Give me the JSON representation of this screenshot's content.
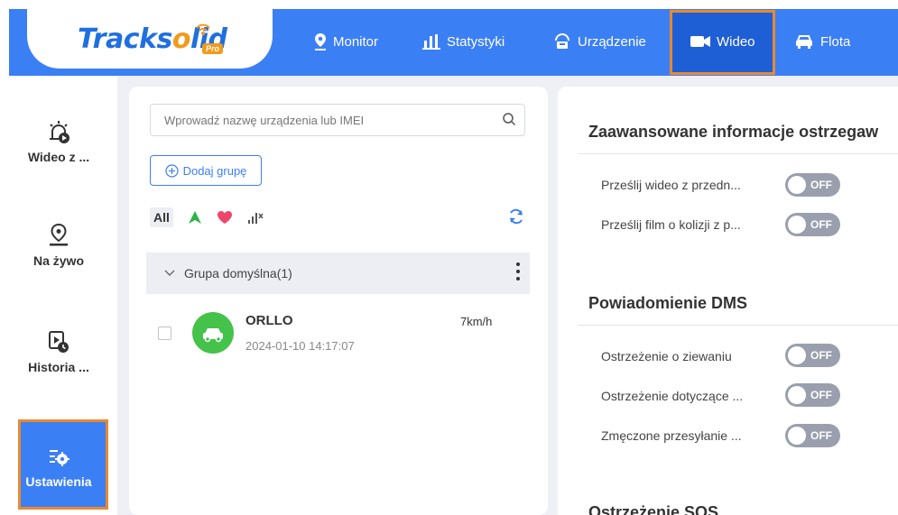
{
  "app": {
    "logo_text_1": "Tracks",
    "logo_text_2": "o",
    "logo_text_3": "lid",
    "logo_badge": "Pro"
  },
  "topnav": {
    "items": [
      {
        "label": "Monitor",
        "icon": "location-pin-icon"
      },
      {
        "label": "Statystyki",
        "icon": "bar-chart-icon"
      },
      {
        "label": "Urządzenie",
        "icon": "device-icon"
      },
      {
        "label": "Wideo",
        "icon": "video-camera-icon",
        "active": true
      },
      {
        "label": "Flota",
        "icon": "car-icon"
      }
    ]
  },
  "sidebar": {
    "items": [
      {
        "label": "Wideo z ...",
        "icon": "alarm-video-icon"
      },
      {
        "label": "Na żywo",
        "icon": "live-pin-icon"
      },
      {
        "label": "Historia ...",
        "icon": "history-play-icon"
      },
      {
        "label": "Ustawienia",
        "icon": "settings-gear-icon",
        "active": true
      }
    ]
  },
  "devices": {
    "search_placeholder": "Wprowadź nazwę urządzenia lub IMEI",
    "add_group_label": "Dodaj grupę",
    "filter_all": "All",
    "group_name": "Grupa domyślna(1)",
    "list": [
      {
        "name": "ORLLO",
        "time": "2024-01-10 14:17:07",
        "speed": "7km/h"
      }
    ]
  },
  "settings": {
    "sections": [
      {
        "title": "Zaawansowane informacje ostrzegaw",
        "rows": [
          {
            "label": "Prześlij wideo z przedn...",
            "state": "OFF"
          },
          {
            "label": "Prześlij film o kolizji z p...",
            "state": "OFF"
          }
        ]
      },
      {
        "title": "Powiadomienie DMS",
        "rows": [
          {
            "label": "Ostrzeżenie o ziewaniu",
            "state": "OFF"
          },
          {
            "label": "Ostrzeżenie dotyczące ...",
            "state": "OFF"
          },
          {
            "label": "Zmęczone przesyłanie ...",
            "state": "OFF"
          }
        ]
      },
      {
        "title": "Ostrzeżenie SOS",
        "rows": []
      }
    ]
  },
  "colors": {
    "brand_blue": "#3b7ff5",
    "active_blue": "#1f5fd6",
    "highlight_orange": "#e98a2f",
    "device_online": "#45c24a"
  }
}
